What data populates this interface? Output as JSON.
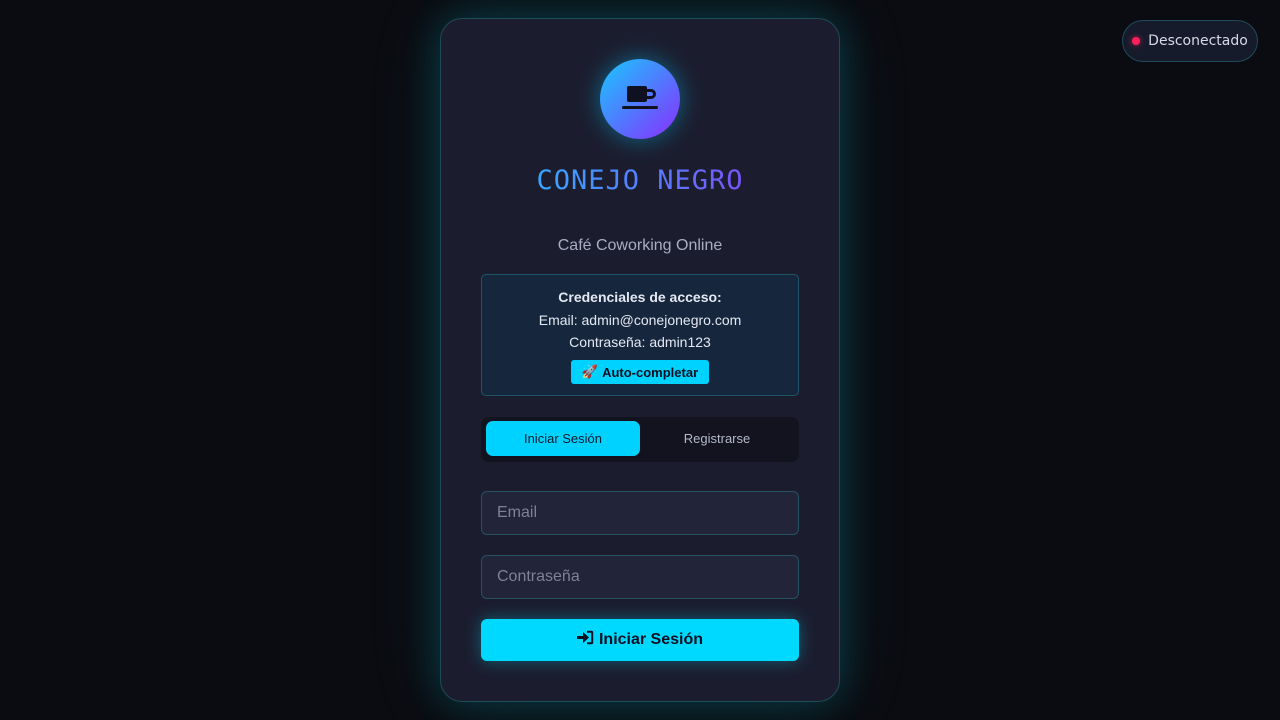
{
  "status": {
    "label": "Desconectado",
    "color": "#ff1f5a"
  },
  "brand": {
    "name": "CONEJO NEGRO",
    "subtitle": "Café Coworking Online",
    "logo_icon": "coffee-cup-icon"
  },
  "credentials": {
    "title": "Credenciales de acceso:",
    "email_line": "Email: admin@conejonegro.com",
    "password_line": "Contraseña: admin123",
    "autofill_icon": "🚀",
    "autofill_label": "Auto-completar"
  },
  "tabs": [
    {
      "label": "Iniciar Sesión",
      "active": true
    },
    {
      "label": "Registrarse",
      "active": false
    }
  ],
  "form": {
    "email_placeholder": "Email",
    "email_value": "",
    "password_placeholder": "Contraseña",
    "password_value": "",
    "submit_icon": "sign-in-icon",
    "submit_label": "Iniciar Sesión"
  },
  "colors": {
    "accent": "#00d9ff",
    "card_bg": "#1b1d2e",
    "page_bg": "#0b0c11"
  }
}
